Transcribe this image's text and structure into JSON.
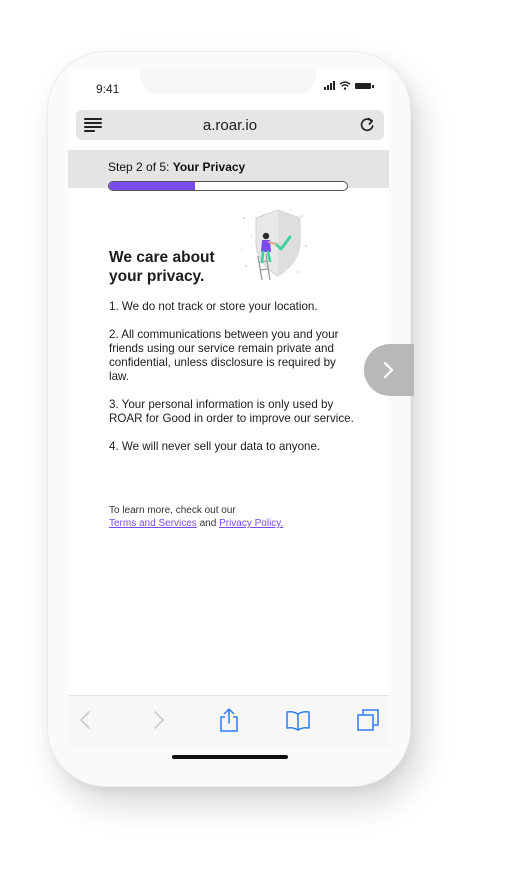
{
  "status_bar": {
    "time": "9:41"
  },
  "browser": {
    "url": "a.roar.io"
  },
  "step": {
    "prefix": "Step 2 of 5:",
    "title": "Your Privacy",
    "progress": 0.36
  },
  "headline": {
    "line1": "We care about",
    "line2": "your privacy."
  },
  "points": [
    "1. We do not track or store your location.",
    "2. All communications between you and your friends using our service remain private and confidential, unless disclosure is required by law.",
    "3. Your personal information is only used by ROAR for Good in order to improve our service.",
    "4. We will never sell your data to anyone."
  ],
  "learn_more": {
    "intro": "To learn more, check out our",
    "terms_link": "Terms and Services",
    "joiner": "and",
    "privacy_link": "Privacy Policy."
  },
  "toolbar": {
    "icons": [
      "back-icon",
      "forward-icon",
      "share-icon",
      "bookmarks-icon",
      "tabs-icon"
    ]
  },
  "colors": {
    "accent": "#7B4BF0",
    "check": "#3DD3A0",
    "ios_blue": "#2F7CF6"
  }
}
